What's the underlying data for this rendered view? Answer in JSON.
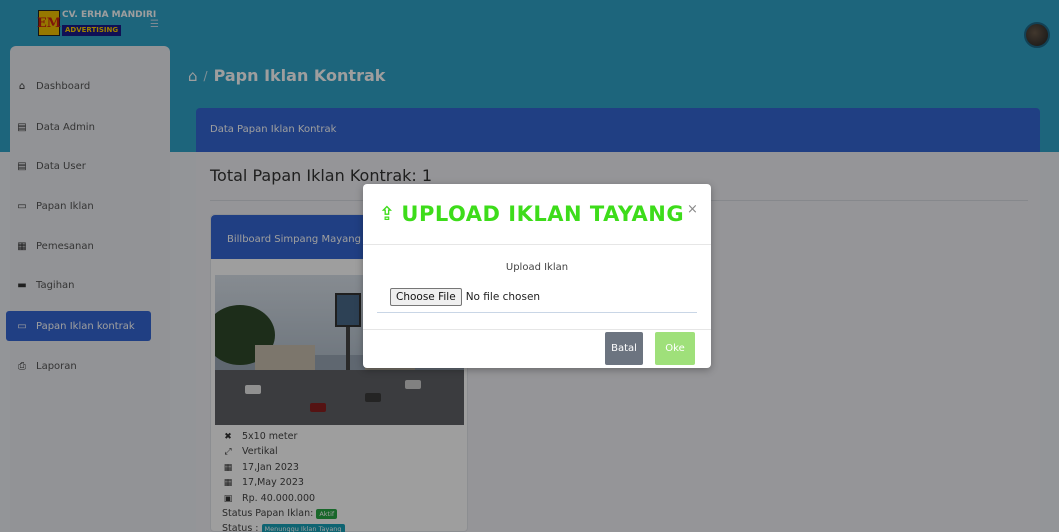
{
  "brand": {
    "logo_letters": "EM",
    "name": "CV. ERHA MANDIRI",
    "tagline": "ADVERTISING"
  },
  "header": {
    "menu_icon": "hamburger-icon",
    "avatar_icon": "user-avatar"
  },
  "sidebar": {
    "items": [
      {
        "label": "Dashboard",
        "icon": "home-icon"
      },
      {
        "label": "Data Admin",
        "icon": "id-card-icon"
      },
      {
        "label": "Data User",
        "icon": "id-card-icon"
      },
      {
        "label": "Papan Iklan",
        "icon": "monitor-icon"
      },
      {
        "label": "Pemesanan",
        "icon": "list-icon"
      },
      {
        "label": "Tagihan",
        "icon": "id-badge-icon"
      },
      {
        "label": "Papan Iklan kontrak",
        "icon": "display-icon",
        "active": true
      },
      {
        "label": "Laporan",
        "icon": "printer-icon"
      }
    ]
  },
  "breadcrumb": {
    "separator": "/",
    "title": "Papn Iklan Kontrak"
  },
  "panel": {
    "header": "Data Papan Iklan Kontrak",
    "total_label": "Total Papan Iklan Kontrak: 1"
  },
  "card": {
    "title": "Billboard Simpang Mayang I",
    "size": "5x10 meter",
    "orientation": "Vertikal",
    "start_date": "17,Jan 2023",
    "end_date": "17,May 2023",
    "price": "Rp. 40.000.000",
    "status_board_label": "Status Papan Iklan:",
    "status_board_value": "Aktif",
    "status_label": "Status :",
    "status_value": "Menunggu Iklan Tayang"
  },
  "modal": {
    "title": "UPLOAD IKLAN TAYANG",
    "close": "×",
    "upload_label": "Upload Iklan",
    "choose_file": "Choose File",
    "no_file": "No file chosen",
    "cancel": "Batal",
    "ok": "Oke"
  },
  "colors": {
    "primary": "#3466d4",
    "topbar": "#2fa3c9",
    "success": "#28a745",
    "title_green": "#3ddc1a",
    "oke": "#9fe07a",
    "batal": "#6c7480"
  }
}
